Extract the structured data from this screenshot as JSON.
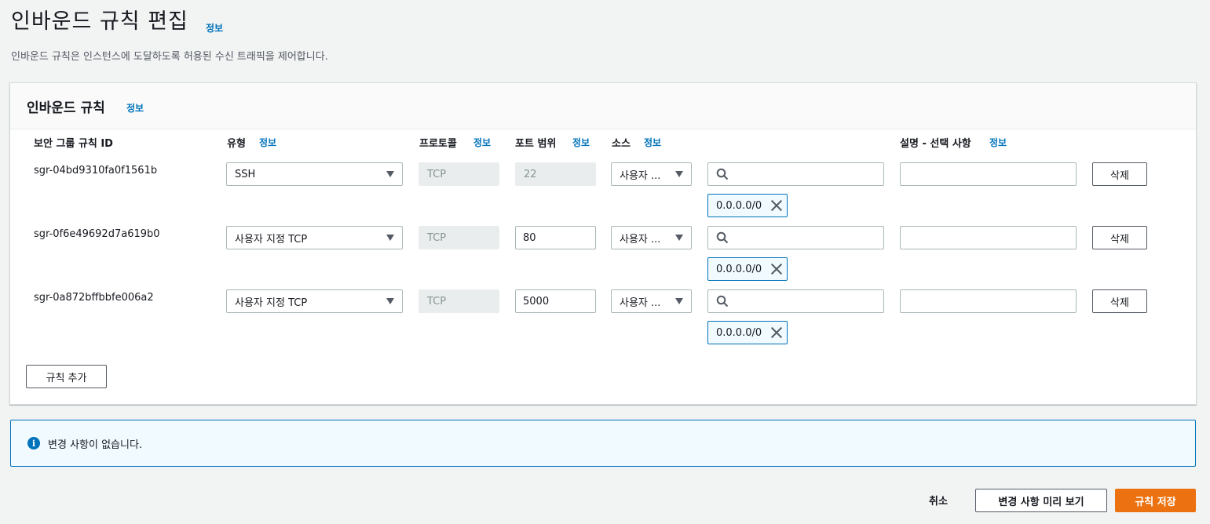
{
  "page": {
    "title": "인바운드 규칙 편집",
    "title_info": "정보",
    "description": "인바운드 규칙은 인스턴스에 도달하도록 허용된 수신 트래픽을 제어합니다."
  },
  "panel": {
    "title": "인바운드 규칙",
    "title_info": "정보",
    "columns": {
      "rule_id": "보안 그룹 규칙 ID",
      "type": "유형",
      "protocol": "프로토콜",
      "port_range": "포트 범위",
      "source": "소스",
      "description": "설명 - 선택 사항",
      "info": "정보"
    },
    "rules": [
      {
        "id": "sgr-04bd9310fa0f1561b",
        "type": "SSH",
        "protocol": "TCP",
        "port": "22",
        "port_editable": false,
        "source": "사용자 ...",
        "cidr": "0.0.0.0/0",
        "delete": "삭제"
      },
      {
        "id": "sgr-0f6e49692d7a619b0",
        "type": "사용자 지정 TCP",
        "protocol": "TCP",
        "port": "80",
        "port_editable": true,
        "source": "사용자 ...",
        "cidr": "0.0.0.0/0",
        "delete": "삭제"
      },
      {
        "id": "sgr-0a872bffbbfe006a2",
        "type": "사용자 지정 TCP",
        "protocol": "TCP",
        "port": "5000",
        "port_editable": true,
        "source": "사용자 ...",
        "cidr": "0.0.0.0/0",
        "delete": "삭제"
      }
    ],
    "add_rule": "규칙 추가"
  },
  "alert": {
    "text": "변경 사항이 없습니다.",
    "icon": "info-icon",
    "icon_glyph": "i"
  },
  "footer": {
    "cancel": "취소",
    "preview": "변경 사항 미리 보기",
    "save": "규칙 저장"
  },
  "colors": {
    "link": "#0073bb",
    "primary": "#ec7211",
    "background": "#f2f3f3"
  }
}
